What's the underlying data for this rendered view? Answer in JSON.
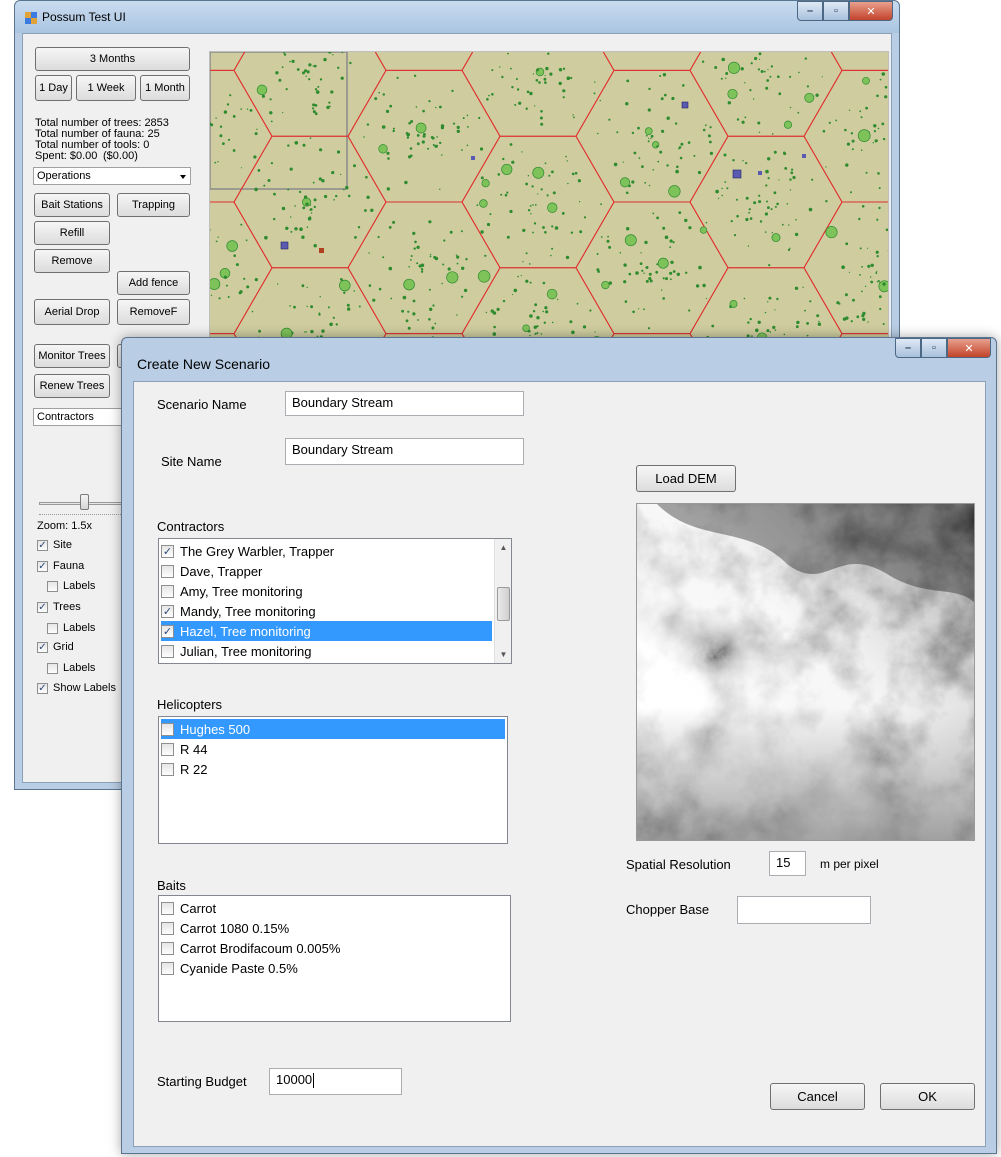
{
  "main_window": {
    "title": "Possum Test UI",
    "duration_buttons": {
      "three_months": "3 Months",
      "one_day": "1 Day",
      "one_week": "1 Week",
      "one_month": "1 Month"
    },
    "stats": {
      "trees": "Total number of trees: 2853",
      "fauna": "Total number of fauna: 25",
      "tools": "Total number of tools: 0",
      "spent": "Spent: $0.00",
      "spent_paren": "($0.00)"
    },
    "operations_combo": "Operations",
    "buttons": {
      "bait_stations": "Bait Stations",
      "trapping": "Trapping",
      "refill": "Refill",
      "remove": "Remove",
      "add_fence": "Add fence",
      "aerial_drop": "Aerial Drop",
      "remove_f": "RemoveF",
      "monitor_trees": "Monitor Trees",
      "renew_trees": "Renew Trees"
    },
    "contractors_combo": "Contractors",
    "zoom_label": "Zoom: 1.5x",
    "zoom_fraction": 0.5,
    "checkboxes": [
      {
        "label": "Site",
        "checked": true
      },
      {
        "label": "Fauna",
        "checked": true
      },
      {
        "label": "Labels",
        "checked": false
      },
      {
        "label": "Trees",
        "checked": true
      },
      {
        "label": "Labels",
        "checked": false
      },
      {
        "label": "Grid",
        "checked": true
      },
      {
        "label": "Labels",
        "checked": false
      },
      {
        "label": "Show Labels",
        "checked": true
      }
    ]
  },
  "dialog": {
    "title": "Create New Scenario",
    "scenario_name_label": "Scenario Name",
    "scenario_name_value": "Boundary Stream",
    "site_name_label": "Site Name",
    "site_name_value": "Boundary Stream",
    "contractors_label": "Contractors",
    "contractors": [
      {
        "label": "The Grey Warbler, Trapper",
        "checked": true,
        "selected": false
      },
      {
        "label": "Dave, Trapper",
        "checked": false,
        "selected": false
      },
      {
        "label": "Amy, Tree monitoring",
        "checked": false,
        "selected": false
      },
      {
        "label": "Mandy, Tree monitoring",
        "checked": true,
        "selected": false
      },
      {
        "label": "Hazel, Tree monitoring",
        "checked": true,
        "selected": true
      },
      {
        "label": "Julian, Tree monitoring",
        "checked": false,
        "selected": false
      }
    ],
    "helicopters_label": "Helicopters",
    "helicopters": [
      {
        "label": "Hughes 500",
        "checked": false,
        "selected": true
      },
      {
        "label": "R 44",
        "checked": false,
        "selected": false
      },
      {
        "label": "R 22",
        "checked": false,
        "selected": false
      }
    ],
    "baits_label": "Baits",
    "baits": [
      {
        "label": "Carrot",
        "checked": false
      },
      {
        "label": "Carrot 1080 0.15%",
        "checked": false
      },
      {
        "label": "Carrot Brodifacoum 0.005%",
        "checked": false
      },
      {
        "label": "Cyanide Paste 0.5%",
        "checked": false
      }
    ],
    "load_dem_label": "Load DEM",
    "spatial_resolution_label": "Spatial Resolution",
    "spatial_resolution_value": "15",
    "spatial_resolution_unit": "m per pixel",
    "chopper_base_label": "Chopper Base",
    "chopper_base_value": "",
    "starting_budget_label": "Starting Budget",
    "starting_budget_value": "10000",
    "cancel_label": "Cancel",
    "ok_label": "OK"
  },
  "colors": {
    "map_background": "#cfcd9f",
    "hex_grid_line": "#e03030",
    "tree_green": "#2e8b2e",
    "selection_blue": "#3399ff"
  }
}
